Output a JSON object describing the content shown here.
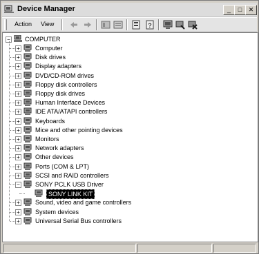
{
  "window": {
    "title": "Device Manager",
    "controls": {
      "minimize": "_",
      "maximize": "□",
      "close": "✕"
    }
  },
  "menu": {
    "action": "Action",
    "view": "View"
  },
  "toolbar": {
    "icons": [
      "back-arrow",
      "forward-arrow",
      "show-hide-icon",
      "properties-page-icon",
      "properties-icon",
      "help-icon",
      "scan-hardware-icon",
      "update-driver-icon",
      "uninstall-icon"
    ]
  },
  "tree": {
    "root": "COMPUTER",
    "items": [
      {
        "label": "Computer",
        "icon": "computer-icon",
        "expander": "+"
      },
      {
        "label": "Disk drives",
        "icon": "disk-icon",
        "expander": "+"
      },
      {
        "label": "Display adapters",
        "icon": "display-icon",
        "expander": "+"
      },
      {
        "label": "DVD/CD-ROM drives",
        "icon": "cd-icon",
        "expander": "+"
      },
      {
        "label": "Floppy disk controllers",
        "icon": "controller-icon",
        "expander": "+"
      },
      {
        "label": "Floppy disk drives",
        "icon": "floppy-icon",
        "expander": "+"
      },
      {
        "label": "Human Interface Devices",
        "icon": "hid-icon",
        "expander": "+"
      },
      {
        "label": "IDE ATA/ATAPI controllers",
        "icon": "ide-icon",
        "expander": "+"
      },
      {
        "label": "Keyboards",
        "icon": "keyboard-icon",
        "expander": "+"
      },
      {
        "label": "Mice and other pointing devices",
        "icon": "mouse-icon",
        "expander": "+"
      },
      {
        "label": "Monitors",
        "icon": "monitor-icon",
        "expander": "+"
      },
      {
        "label": "Network adapters",
        "icon": "network-icon",
        "expander": "+"
      },
      {
        "label": "Other devices",
        "icon": "unknown-device-icon",
        "expander": "+"
      },
      {
        "label": "Ports (COM & LPT)",
        "icon": "port-icon",
        "expander": "+"
      },
      {
        "label": "SCSI and RAID controllers",
        "icon": "scsi-icon",
        "expander": "+"
      },
      {
        "label": "SONY PCLK USB Driver",
        "icon": "usb-icon",
        "expander": "−"
      },
      {
        "label": "SONY LINK KIT",
        "icon": "usb-icon",
        "expander": ""
      },
      {
        "label": "Sound, video and game controllers",
        "icon": "sound-icon",
        "expander": "+"
      },
      {
        "label": "System devices",
        "icon": "system-icon",
        "expander": "+"
      },
      {
        "label": "Universal Serial Bus controllers",
        "icon": "usb-icon",
        "expander": "+"
      }
    ]
  }
}
